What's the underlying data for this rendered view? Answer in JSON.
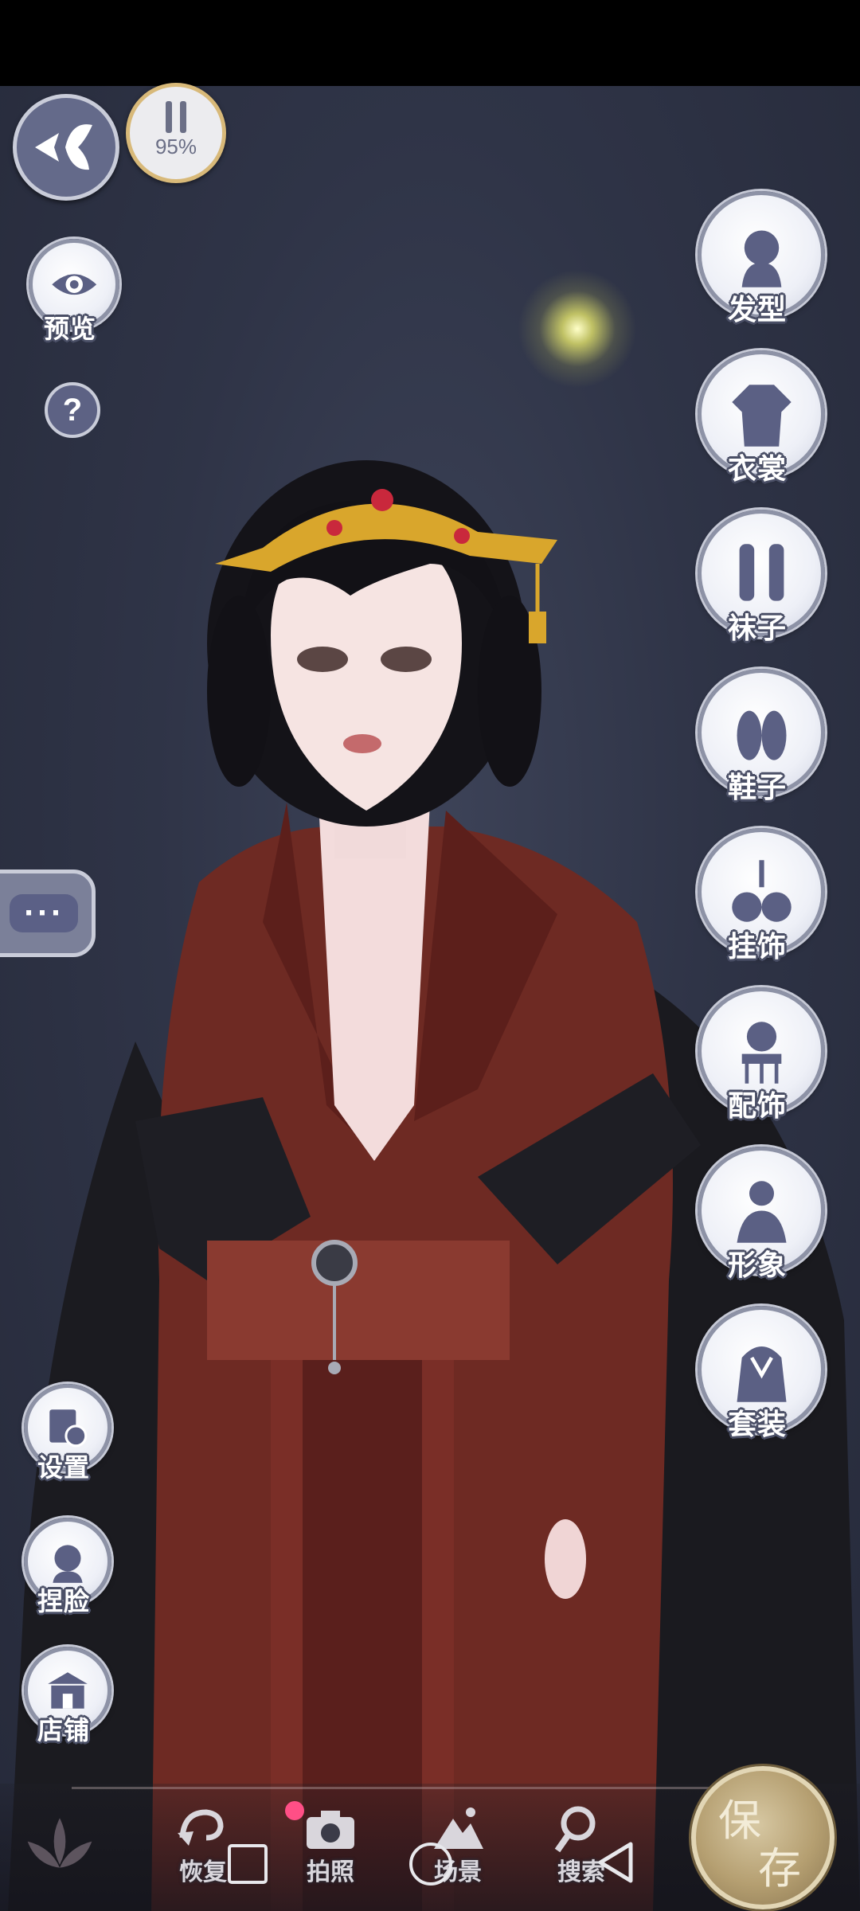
{
  "hud": {
    "fps_percent": "95%",
    "preview_label": "预览",
    "help_glyph": "?",
    "chat_glyph": "···"
  },
  "right_menu": [
    {
      "label": "发型",
      "icon": "hairstyle-icon"
    },
    {
      "label": "衣裳",
      "icon": "clothing-icon"
    },
    {
      "label": "袜子",
      "icon": "socks-icon"
    },
    {
      "label": "鞋子",
      "icon": "shoes-icon"
    },
    {
      "label": "挂饰",
      "icon": "pendant-icon"
    },
    {
      "label": "配饰",
      "icon": "accessory-icon"
    },
    {
      "label": "形象",
      "icon": "appearance-icon"
    },
    {
      "label": "套装",
      "icon": "outfit-set-icon"
    }
  ],
  "left_menu": [
    {
      "label": "设置",
      "icon": "settings-icon"
    },
    {
      "label": "捏脸",
      "icon": "face-edit-icon"
    },
    {
      "label": "店铺",
      "icon": "shop-icon"
    }
  ],
  "dock": {
    "restore_label": "恢复",
    "photo_label": "拍照",
    "scene_label": "场景",
    "search_label": "搜索"
  },
  "save": {
    "char1": "保",
    "char2": "存"
  },
  "colors": {
    "background": "#2f3447",
    "button_border": "#8d92a6",
    "label_outline": "#4a4f66",
    "save_gold": "#b59f71",
    "notification_dot": "#ff4f86"
  }
}
